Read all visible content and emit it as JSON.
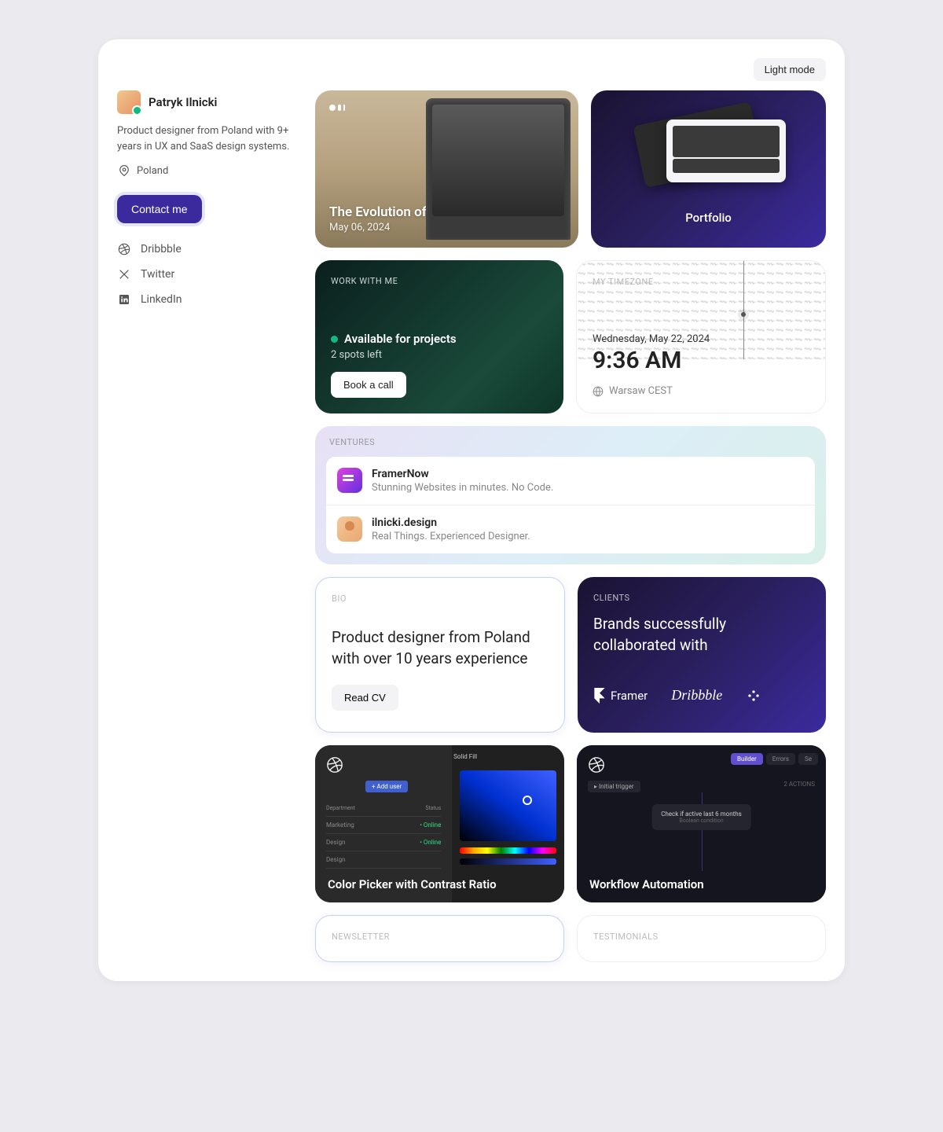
{
  "theme_button": "Light mode",
  "profile": {
    "name": "Patryk Ilnicki",
    "bio": "Product designer from Poland with 9+ years in UX and SaaS design systems.",
    "location": "Poland",
    "contact_button": "Contact me"
  },
  "socials": [
    {
      "label": "Dribbble",
      "icon": "dribbble"
    },
    {
      "label": "Twitter",
      "icon": "twitter"
    },
    {
      "label": "LinkedIn",
      "icon": "linkedin"
    }
  ],
  "article": {
    "title": "The Evolution of Online Media",
    "date": "May 06, 2024"
  },
  "portfolio": {
    "title": "Portfolio"
  },
  "work": {
    "label": "WORK WITH ME",
    "available": "Available for projects",
    "spots": "2 spots left",
    "button": "Book a call"
  },
  "timezone": {
    "label": "MY TIMEZONE",
    "date": "Wednesday, May 22, 2024",
    "time": "9:36 AM",
    "location": "Warsaw CEST"
  },
  "ventures": {
    "label": "VENTURES",
    "items": [
      {
        "name": "FramerNow",
        "desc": "Stunning Websites in minutes. No Code."
      },
      {
        "name": "ilnicki.design",
        "desc": "Real Things. Experienced Designer."
      }
    ]
  },
  "bio_card": {
    "label": "BIO",
    "text": "Product designer from Poland with over 10 years experience",
    "button": "Read CV"
  },
  "clients": {
    "label": "CLIENTS",
    "title": "Brands successfully collaborated with",
    "logos": [
      "Framer",
      "Dribbble",
      "Slack"
    ]
  },
  "shots": [
    {
      "title": "Color Picker with Contrast Ratio"
    },
    {
      "title": "Workflow Automation"
    }
  ],
  "shot_mock": {
    "solid_fill": "Solid Fill",
    "add_user": "+   Add user",
    "dept_hdr": "Department",
    "status_hdr": "Status",
    "rows": [
      {
        "dept": "Marketing",
        "status": "• Online"
      },
      {
        "dept": "Design",
        "status": "• Online"
      },
      {
        "dept": "Design",
        "status": ""
      }
    ],
    "wf_tabs": [
      "Builder",
      "Errors",
      "Se"
    ],
    "wf_trigger": "▸ Initial trigger",
    "wf_actions": "2 ACTIONS",
    "wf_node_main": "Check if active last 6 months",
    "wf_node_sub": "Boolean condition"
  },
  "newsletter": {
    "label": "NEWSLETTER"
  },
  "testimonials": {
    "label": "TESTIMONIALS"
  }
}
